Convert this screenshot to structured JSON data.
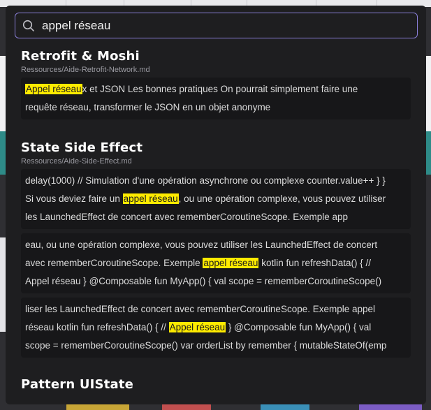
{
  "search": {
    "query": "appel réseau"
  },
  "results": [
    {
      "title": "Retrofit & Moshi",
      "path": "Ressources/Aide-Retrofit-Network.md",
      "snippets": [
        {
          "lines": [
            {
              "pre": "",
              "hl": "Appel réseau",
              "post": "x et JSON Les bonnes pratiques On pourrait simplement faire une"
            },
            {
              "pre": "requête réseau, transformer le JSON en un objet anonyme",
              "hl": "",
              "post": ""
            }
          ]
        }
      ]
    },
    {
      "title": "State Side Effect",
      "path": "Ressources/Aide-Side-Effect.md",
      "snippets": [
        {
          "lines": [
            {
              "pre": "delay(1000) // Simulation d'une opération asynchrone ou complexe counter.value++ } }",
              "hl": "",
              "post": ""
            },
            {
              "pre": "Si vous deviez faire un ",
              "hl": "appel réseau",
              "post": ", ou une opération complexe, vous pouvez utiliser"
            },
            {
              "pre": "les LaunchedEffect de concert avec rememberCoroutineScope. Exemple app",
              "hl": "",
              "post": ""
            }
          ]
        },
        {
          "lines": [
            {
              "pre": "eau, ou une opération complexe, vous pouvez utiliser les LaunchedEffect de concert",
              "hl": "",
              "post": ""
            },
            {
              "pre": "avec rememberCoroutineScope. Exemple ",
              "hl": "appel réseau",
              "post": " kotlin fun refreshData() { //"
            },
            {
              "pre": "Appel réseau } @Composable fun MyApp() { val scope = rememberCoroutineScope()",
              "hl": "",
              "post": ""
            }
          ]
        },
        {
          "lines": [
            {
              "pre": "liser les LaunchedEffect de concert avec rememberCoroutineScope. Exemple appel",
              "hl": "",
              "post": ""
            },
            {
              "pre": "réseau kotlin fun refreshData() { // ",
              "hl": "Appel réseau",
              "post": " } @Composable fun MyApp() { val"
            },
            {
              "pre": "scope = rememberCoroutineScope() var orderList by remember { mutableStateOf(emp",
              "hl": "",
              "post": ""
            }
          ]
        }
      ]
    },
    {
      "title": "Pattern UIState",
      "path": "",
      "snippets": []
    }
  ],
  "colors": {
    "highlight": "#ffeb00",
    "search_border": "#8a7fd8",
    "modal_bg": "#1e1e20",
    "snippet_bg": "#171719"
  },
  "icons": {
    "search": "search-icon"
  }
}
